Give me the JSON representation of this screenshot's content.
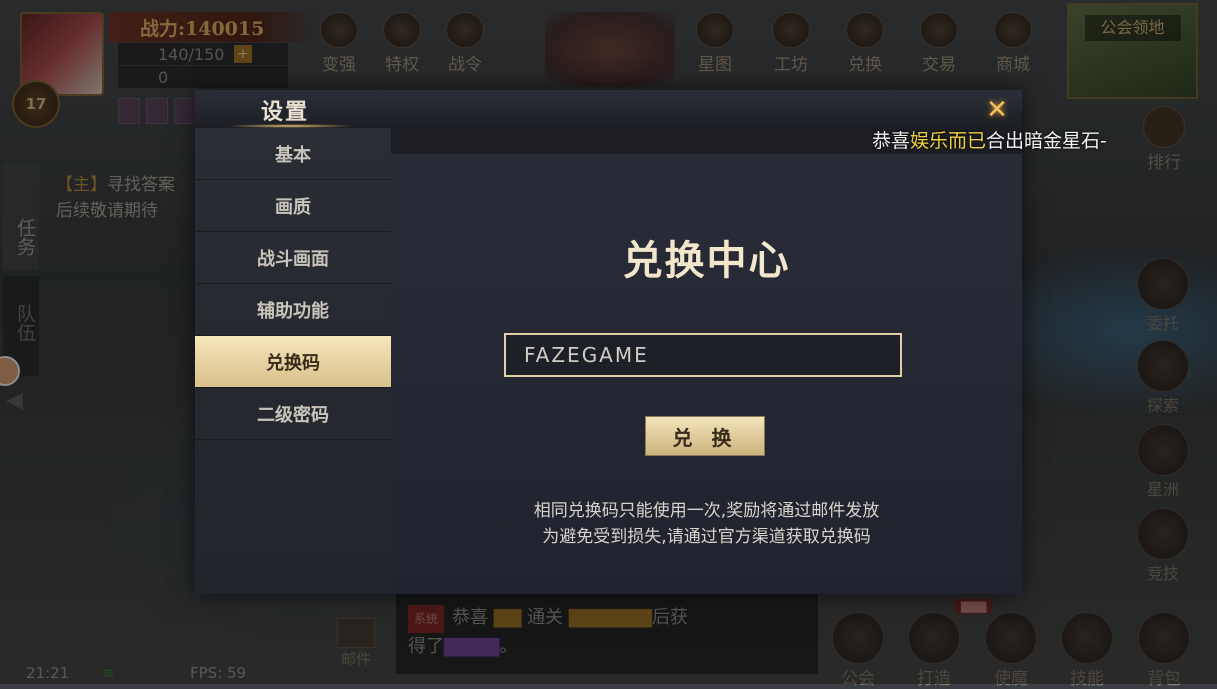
{
  "hud": {
    "power_label": "战力:140015",
    "stamina": "140/150",
    "stamina_plus": "+",
    "diamonds": "0",
    "level": "17"
  },
  "top_bar": [
    {
      "label": "变强"
    },
    {
      "label": "特权"
    },
    {
      "label": "战令"
    },
    {
      "label": "星图"
    },
    {
      "label": "工坊"
    },
    {
      "label": "兑换"
    },
    {
      "label": "交易"
    },
    {
      "label": "商城"
    }
  ],
  "guild_territory": "公会领地",
  "rank": "排行",
  "quest": {
    "task_tab": "任务",
    "team_tab": "队伍",
    "tag": "【主】",
    "title": "寻找答案",
    "subtitle": "后续敬请期待"
  },
  "right_column": [
    {
      "label": "委托"
    },
    {
      "label": "探索"
    },
    {
      "label": "星洲"
    },
    {
      "label": "竞技"
    }
  ],
  "broadcast": {
    "prefix": "恭喜",
    "name": "娱乐而已",
    "suffix": "合出暗金星石-"
  },
  "status": {
    "time": "21:21",
    "fps": "FPS: 59"
  },
  "chat": {
    "sys_tag": "系统",
    "line1a": "恭喜",
    "line1b": "通关",
    "line1c": "后获",
    "line2": "得了"
  },
  "bottom_bar": [
    {
      "label": "公会"
    },
    {
      "label": "打造"
    },
    {
      "label": "使魔"
    },
    {
      "label": "技能"
    },
    {
      "label": "背包"
    }
  ],
  "mail": "邮件",
  "settings": {
    "title": "设置",
    "close_icon": "close-x-icon",
    "menu": [
      {
        "label": "基本",
        "active": false
      },
      {
        "label": "画质",
        "active": false
      },
      {
        "label": "战斗画面",
        "active": false
      },
      {
        "label": "辅助功能",
        "active": false
      },
      {
        "label": "兑换码",
        "active": true
      },
      {
        "label": "二级密码",
        "active": false
      }
    ],
    "redeem": {
      "heading": "兑换中心",
      "code_value": "FAZEGAME",
      "button_label": "兑 换",
      "note_line1": "相同兑换码只能使用一次,奖励将通过邮件发放",
      "note_line2": "为避免受到损失,请通过官方渠道获取兑换码"
    }
  },
  "colors": {
    "accent_gold": "#e0d0a8",
    "active_menu": "#f6e6bc",
    "broadcast_name": "#f0d040"
  }
}
